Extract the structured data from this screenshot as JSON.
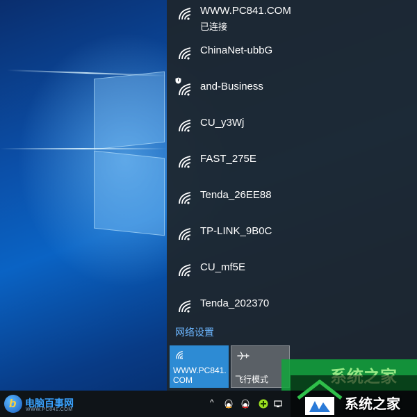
{
  "networks": [
    {
      "ssid": "WWW.PC841.COM",
      "status": "已连接",
      "secured": false
    },
    {
      "ssid": "ChinaNet-ubbG",
      "status": "",
      "secured": false
    },
    {
      "ssid": "and-Business",
      "status": "",
      "secured": true
    },
    {
      "ssid": "CU_y3Wj",
      "status": "",
      "secured": false
    },
    {
      "ssid": "FAST_275E",
      "status": "",
      "secured": false
    },
    {
      "ssid": "Tenda_26EE88",
      "status": "",
      "secured": false
    },
    {
      "ssid": "TP-LINK_9B0C",
      "status": "",
      "secured": false
    },
    {
      "ssid": "CU_mf5E",
      "status": "",
      "secured": false
    },
    {
      "ssid": "Tenda_202370",
      "status": "",
      "secured": false
    }
  ],
  "network_settings_link": "网络设置",
  "quick_actions": {
    "wifi_tile_label_line1": "WWW.PC841.",
    "wifi_tile_label_line2": "COM",
    "airplane_tile_label": "飞行模式"
  },
  "taskbar": {
    "brand_mark": "b",
    "brand_name": "电脑百事网",
    "brand_url": "WWW.PC841.COM"
  },
  "watermark": {
    "text": "系统之家",
    "partial_text": "系统之家"
  },
  "colors": {
    "accent": "#2d8bd4",
    "link": "#6cb6ff",
    "flyout_bg": "#1e262e",
    "airplane_tile": "#5a6066",
    "watermark_green": "#12a53c"
  }
}
